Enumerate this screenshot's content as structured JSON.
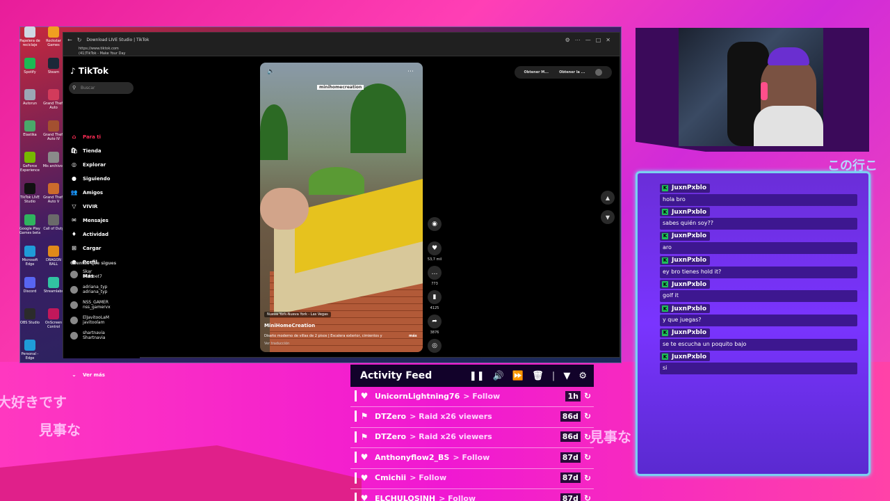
{
  "background": {
    "japanese_left_1": "大好きです",
    "japanese_left_2": "見事な",
    "japanese_right_mid": "見事な",
    "japanese_top_right": "この行こ"
  },
  "desktop": {
    "icons": [
      {
        "label": "Papelera de reciclaje",
        "icon": "recycle-bin-icon",
        "color": "#cfd8e3"
      },
      {
        "label": "Rockstar Games",
        "icon": "rockstar-icon",
        "color": "#f0a020"
      },
      {
        "label": "Spotify",
        "icon": "spotify-icon",
        "color": "#1db954"
      },
      {
        "label": "Steam",
        "icon": "steam-icon",
        "color": "#1b2838"
      },
      {
        "label": "Autorun",
        "icon": "app-icon",
        "color": "#9ba7b5"
      },
      {
        "label": "Grand Theft Auto",
        "icon": "gta-icon",
        "color": "#d23b5b"
      },
      {
        "label": "Elastika",
        "icon": "app-icon",
        "color": "#4aa86a"
      },
      {
        "label": "Grand Theft Auto IV",
        "icon": "gta-icon",
        "color": "#a35030"
      },
      {
        "label": "GeForce Experience",
        "icon": "geforce-icon",
        "color": "#76b900"
      },
      {
        "label": "Mis archivos",
        "icon": "folder-icon",
        "color": "#8a8a8a"
      },
      {
        "label": "TikTok LIVE Studio",
        "icon": "tiktok-icon",
        "color": "#111111"
      },
      {
        "label": "Grand Theft Auto V",
        "icon": "gta-icon",
        "color": "#cc6b2c"
      },
      {
        "label": "Google Play Games beta",
        "icon": "google-play-icon",
        "color": "#2fb35e"
      },
      {
        "label": "Call of Duty",
        "icon": "cod-icon",
        "color": "#6a6a6a"
      },
      {
        "label": "Microsoft Edge",
        "icon": "edge-icon",
        "color": "#1f9cd8"
      },
      {
        "label": "DRAGON BALL",
        "icon": "dragonball-icon",
        "color": "#e08a1a"
      },
      {
        "label": "Discord",
        "icon": "discord-icon",
        "color": "#5865f2"
      },
      {
        "label": "Streamlabs",
        "icon": "streamlabs-icon",
        "color": "#31c3a2"
      },
      {
        "label": "OBS Studio",
        "icon": "obs-icon",
        "color": "#2b2b2b"
      },
      {
        "label": "OnScreen Control",
        "icon": "app-icon",
        "color": "#c2185b"
      },
      {
        "label": "Personal - Edge",
        "icon": "edge-icon",
        "color": "#1f9cd8"
      }
    ]
  },
  "browser": {
    "tab_title": "Download LIVE Studio | TikTok",
    "url": "https://www.tiktok.com",
    "page_title": "(41)TikTok - Make Your Day",
    "window_controls": [
      "minimize",
      "maximize",
      "close"
    ]
  },
  "tiktok": {
    "logo": "TikTok",
    "search_placeholder": "Buscar",
    "nav": [
      {
        "label": "Para ti",
        "icon": "home-icon",
        "active": true
      },
      {
        "label": "Tienda",
        "icon": "shop-icon"
      },
      {
        "label": "Explorar",
        "icon": "compass-icon"
      },
      {
        "label": "Siguiendo",
        "icon": "following-icon"
      },
      {
        "label": "Amigos",
        "icon": "friends-icon"
      },
      {
        "label": "VIVIR",
        "icon": "live-icon"
      },
      {
        "label": "Mensajes",
        "icon": "messages-icon"
      },
      {
        "label": "Actividad",
        "icon": "activity-icon"
      },
      {
        "label": "Cargar",
        "icon": "upload-icon"
      },
      {
        "label": "Perfil",
        "icon": "profile-icon"
      },
      {
        "label": "Más",
        "icon": "more-icon"
      }
    ],
    "following_header": "Cuentas que sigues",
    "following": [
      {
        "name": "Skar",
        "handle": "skarloet7"
      },
      {
        "name": "adriana_typ",
        "handle": "adriana_typ"
      },
      {
        "name": "NSS_GAMER",
        "handle": "nss_gamervx"
      },
      {
        "name": "ElJavitooLaM",
        "handle": "javitoolam"
      },
      {
        "name": "shartnavia",
        "handle": "Shartnavia"
      }
    ],
    "see_more": "Ver más",
    "top_buttons": [
      "Obtener M...",
      "Obtener la ..."
    ],
    "video": {
      "watermark": "minihomecreation",
      "location": "Nueva York-Nueva York - Las Vegas",
      "author": "MiniHomeCreation",
      "description": "Diseño moderno de villas de 2 pisos | Escalera exterior, cimientos y",
      "more": "más",
      "translate": "Ver traducción"
    },
    "actions": [
      {
        "icon": "avatar-icon",
        "count": ""
      },
      {
        "icon": "heart-icon",
        "count": "53,7 mil"
      },
      {
        "icon": "comment-icon",
        "count": "773"
      },
      {
        "icon": "bookmark-icon",
        "count": "4125"
      },
      {
        "icon": "share-icon",
        "count": "3876"
      },
      {
        "icon": "music-disc-icon",
        "count": ""
      }
    ]
  },
  "chat": {
    "messages": [
      {
        "user": "JuxnPxblo",
        "text": "hola bro"
      },
      {
        "user": "JuxnPxblo",
        "text": "sabes quién soy??"
      },
      {
        "user": "JuxnPxblo",
        "text": "aro"
      },
      {
        "user": "JuxnPxblo",
        "text": "ey bro tienes hold it?"
      },
      {
        "user": "JuxnPxblo",
        "text": "golf it"
      },
      {
        "user": "JuxnPxblo",
        "text": "y que juegas?"
      },
      {
        "user": "JuxnPxblo",
        "text": "se te escucha un poquito bajo"
      },
      {
        "user": "JuxnPxblo",
        "text": "si"
      }
    ],
    "badge_letter": "K",
    "badge_color": "#1fc05a"
  },
  "feed": {
    "title": "Activity Feed",
    "controls": [
      "pause-icon",
      "volume-icon",
      "skip-icon",
      "trash-icon",
      "filter-icon",
      "settings-icon"
    ],
    "events": [
      {
        "user": "UnicornLightning76",
        "event": "> Follow",
        "ago": "1h",
        "icon": "heart-icon"
      },
      {
        "user": "DTZero",
        "event": "> Raid x26 viewers",
        "ago": "86d",
        "icon": "raid-icon"
      },
      {
        "user": "DTZero",
        "event": "> Raid x26 viewers",
        "ago": "86d",
        "icon": "raid-icon"
      },
      {
        "user": "Anthonyflow2_BS",
        "event": "> Follow",
        "ago": "87d",
        "icon": "heart-icon"
      },
      {
        "user": "Cmichii",
        "event": "> Follow",
        "ago": "87d",
        "icon": "heart-icon"
      },
      {
        "user": "ELCHULOSINH",
        "event": "> Follow",
        "ago": "87d",
        "icon": "heart-icon"
      }
    ]
  }
}
